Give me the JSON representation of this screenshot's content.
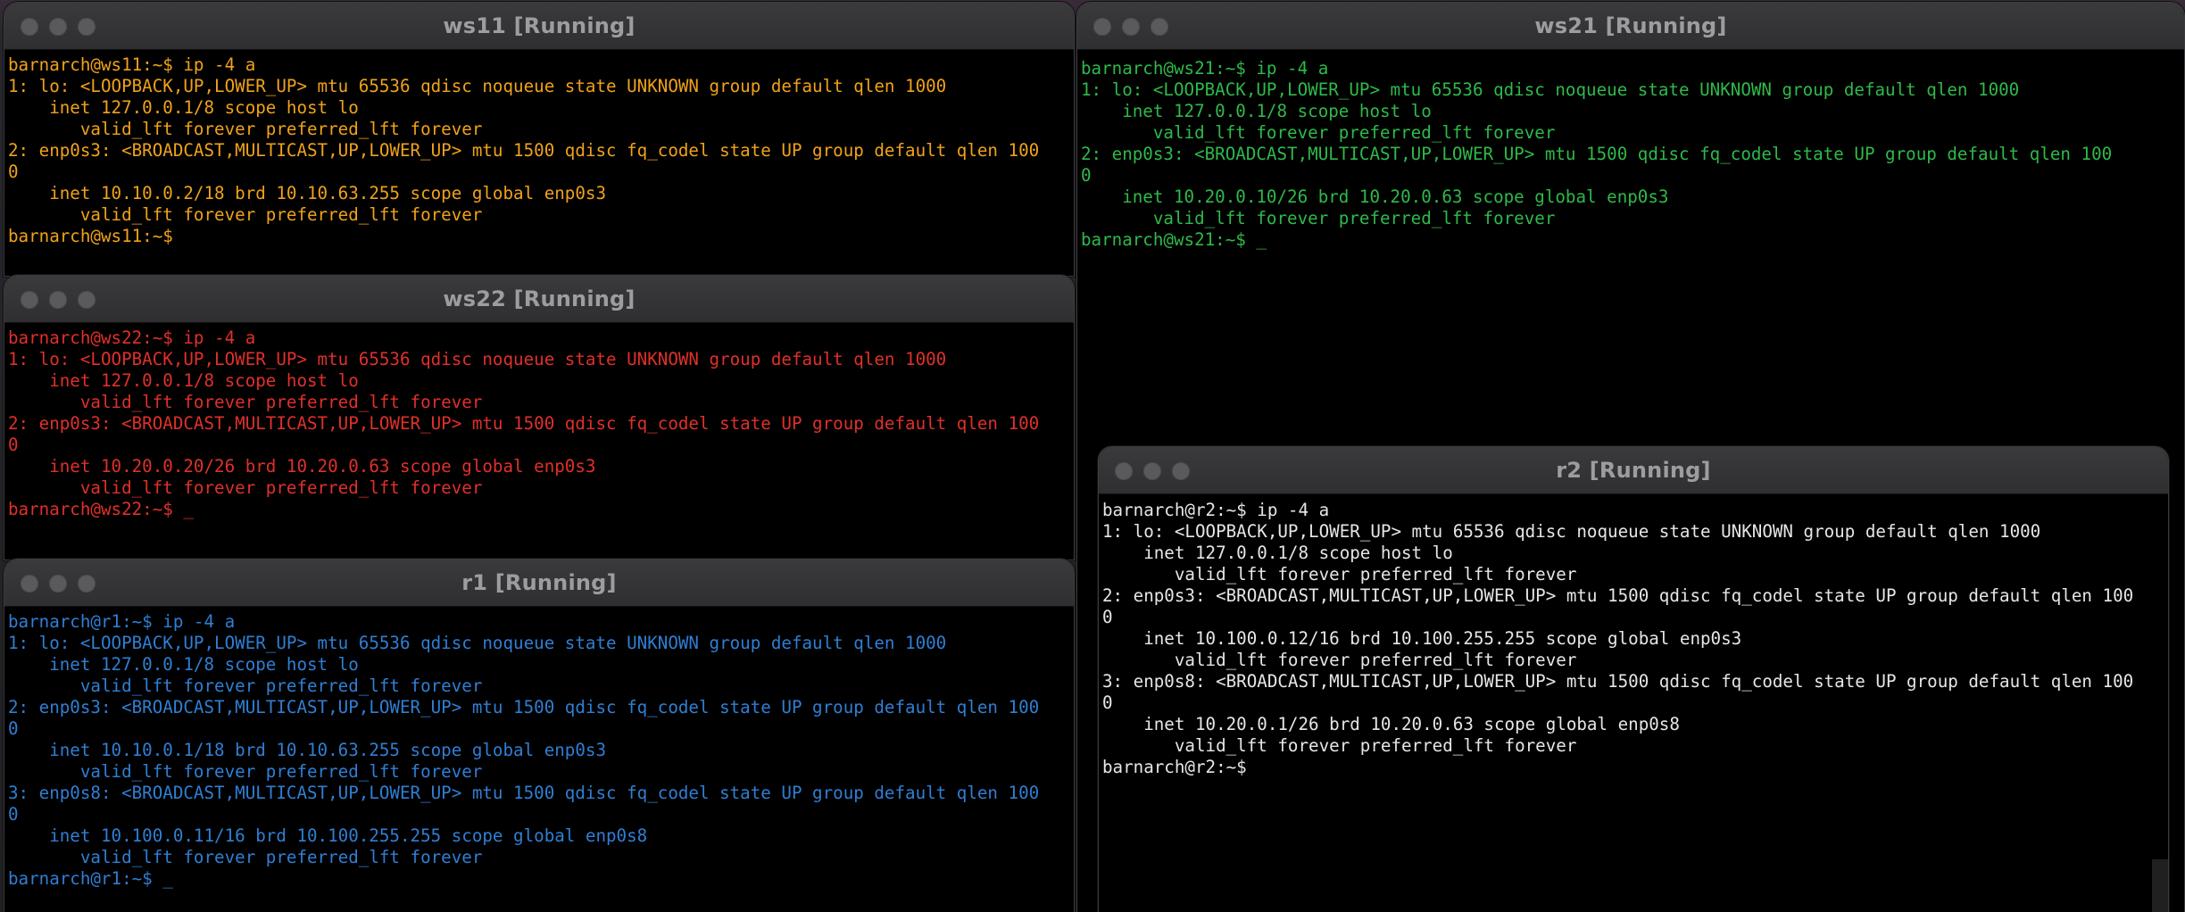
{
  "windows": {
    "ws11": {
      "title": "ws11 [Running]",
      "color": "#f0a21a",
      "lines": [
        "barnarch@ws11:~$ ip -4 a",
        "1: lo: <LOOPBACK,UP,LOWER_UP> mtu 65536 qdisc noqueue state UNKNOWN group default qlen 1000",
        "    inet 127.0.0.1/8 scope host lo",
        "       valid_lft forever preferred_lft forever",
        "2: enp0s3: <BROADCAST,MULTICAST,UP,LOWER_UP> mtu 1500 qdisc fq_codel state UP group default qlen 100",
        "0",
        "    inet 10.10.0.2/18 brd 10.10.63.255 scope global enp0s3",
        "       valid_lft forever preferred_lft forever",
        "barnarch@ws11:~$"
      ]
    },
    "ws22": {
      "title": "ws22 [Running]",
      "color": "#e0302a",
      "lines": [
        "barnarch@ws22:~$ ip -4 a",
        "1: lo: <LOOPBACK,UP,LOWER_UP> mtu 65536 qdisc noqueue state UNKNOWN group default qlen 1000",
        "    inet 127.0.0.1/8 scope host lo",
        "       valid_lft forever preferred_lft forever",
        "2: enp0s3: <BROADCAST,MULTICAST,UP,LOWER_UP> mtu 1500 qdisc fq_codel state UP group default qlen 100",
        "0",
        "    inet 10.20.0.20/26 brd 10.20.0.63 scope global enp0s3",
        "       valid_lft forever preferred_lft forever",
        "barnarch@ws22:~$ _"
      ]
    },
    "r1": {
      "title": "r1 [Running]",
      "color": "#2f7fd4",
      "lines": [
        "barnarch@r1:~$ ip -4 a",
        "1: lo: <LOOPBACK,UP,LOWER_UP> mtu 65536 qdisc noqueue state UNKNOWN group default qlen 1000",
        "    inet 127.0.0.1/8 scope host lo",
        "       valid_lft forever preferred_lft forever",
        "2: enp0s3: <BROADCAST,MULTICAST,UP,LOWER_UP> mtu 1500 qdisc fq_codel state UP group default qlen 100",
        "0",
        "    inet 10.10.0.1/18 brd 10.10.63.255 scope global enp0s3",
        "       valid_lft forever preferred_lft forever",
        "3: enp0s8: <BROADCAST,MULTICAST,UP,LOWER_UP> mtu 1500 qdisc fq_codel state UP group default qlen 100",
        "0",
        "    inet 10.100.0.11/16 brd 10.100.255.255 scope global enp0s8",
        "       valid_lft forever preferred_lft forever",
        "barnarch@r1:~$ _"
      ]
    },
    "ws21": {
      "title": "ws21 [Running]",
      "color": "#2fb94a",
      "lines": [
        "barnarch@ws21:~$ ip -4 a",
        "1: lo: <LOOPBACK,UP,LOWER_UP> mtu 65536 qdisc noqueue state UNKNOWN group default qlen 1000",
        "    inet 127.0.0.1/8 scope host lo",
        "       valid_lft forever preferred_lft forever",
        "2: enp0s3: <BROADCAST,MULTICAST,UP,LOWER_UP> mtu 1500 qdisc fq_codel state UP group default qlen 100",
        "0",
        "    inet 10.20.0.10/26 brd 10.20.0.63 scope global enp0s3",
        "       valid_lft forever preferred_lft forever",
        "barnarch@ws21:~$ _"
      ]
    },
    "r2": {
      "title": "r2 [Running]",
      "color": "#e6e6e6",
      "lines": [
        "barnarch@r2:~$ ip -4 a",
        "1: lo: <LOOPBACK,UP,LOWER_UP> mtu 65536 qdisc noqueue state UNKNOWN group default qlen 1000",
        "    inet 127.0.0.1/8 scope host lo",
        "       valid_lft forever preferred_lft forever",
        "2: enp0s3: <BROADCAST,MULTICAST,UP,LOWER_UP> mtu 1500 qdisc fq_codel state UP group default qlen 100",
        "0",
        "    inet 10.100.0.12/16 brd 10.100.255.255 scope global enp0s3",
        "       valid_lft forever preferred_lft forever",
        "3: enp0s8: <BROADCAST,MULTICAST,UP,LOWER_UP> mtu 1500 qdisc fq_codel state UP group default qlen 100",
        "0",
        "    inet 10.20.0.1/26 brd 10.20.0.63 scope global enp0s8",
        "       valid_lft forever preferred_lft forever",
        "barnarch@r2:~$"
      ]
    }
  },
  "icons": {
    "close": "close-icon",
    "minimize": "minimize-icon",
    "maximize": "maximize-icon"
  }
}
